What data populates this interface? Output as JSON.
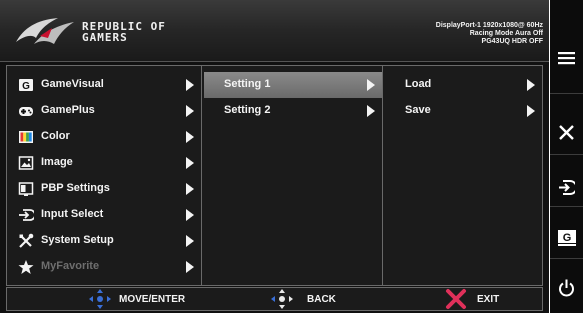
{
  "header": {
    "brand_line1": "REPUBLIC OF",
    "brand_line2": "GAMERS",
    "status_line1": "DisplayPort-1 1920x1080@ 60Hz",
    "status_line2": "Racing Mode Aura Off",
    "status_line3": "PG43UQ HDR OFF"
  },
  "main_menu": [
    {
      "label": "GameVisual",
      "icon": "gamevisual-icon"
    },
    {
      "label": "GamePlus",
      "icon": "gamepad-icon"
    },
    {
      "label": "Color",
      "icon": "color-icon"
    },
    {
      "label": "Image",
      "icon": "image-icon"
    },
    {
      "label": "PBP Settings",
      "icon": "pbp-icon"
    },
    {
      "label": "Input Select",
      "icon": "input-icon"
    },
    {
      "label": "System Setup",
      "icon": "tools-icon"
    },
    {
      "label": "MyFavorite",
      "icon": "star-icon",
      "disabled": true
    }
  ],
  "submenu": [
    {
      "label": "Setting 1",
      "selected": true
    },
    {
      "label": "Setting 2"
    }
  ],
  "options": [
    {
      "label": "Load"
    },
    {
      "label": "Save"
    }
  ],
  "footer": {
    "move_label": "MOVE/ENTER",
    "back_label": "BACK",
    "exit_label": "EXIT"
  },
  "sidebar": [
    {
      "icon": "menu-icon"
    },
    {
      "icon": "close-icon"
    },
    {
      "icon": "input-select-icon"
    },
    {
      "icon": "gamevisual-shortcut-icon"
    },
    {
      "icon": "power-icon"
    }
  ],
  "colors": {
    "selected_bg": "#7a7a7a",
    "exit_x": "#e0305a",
    "joystick_blue": "#3a6fd8"
  }
}
